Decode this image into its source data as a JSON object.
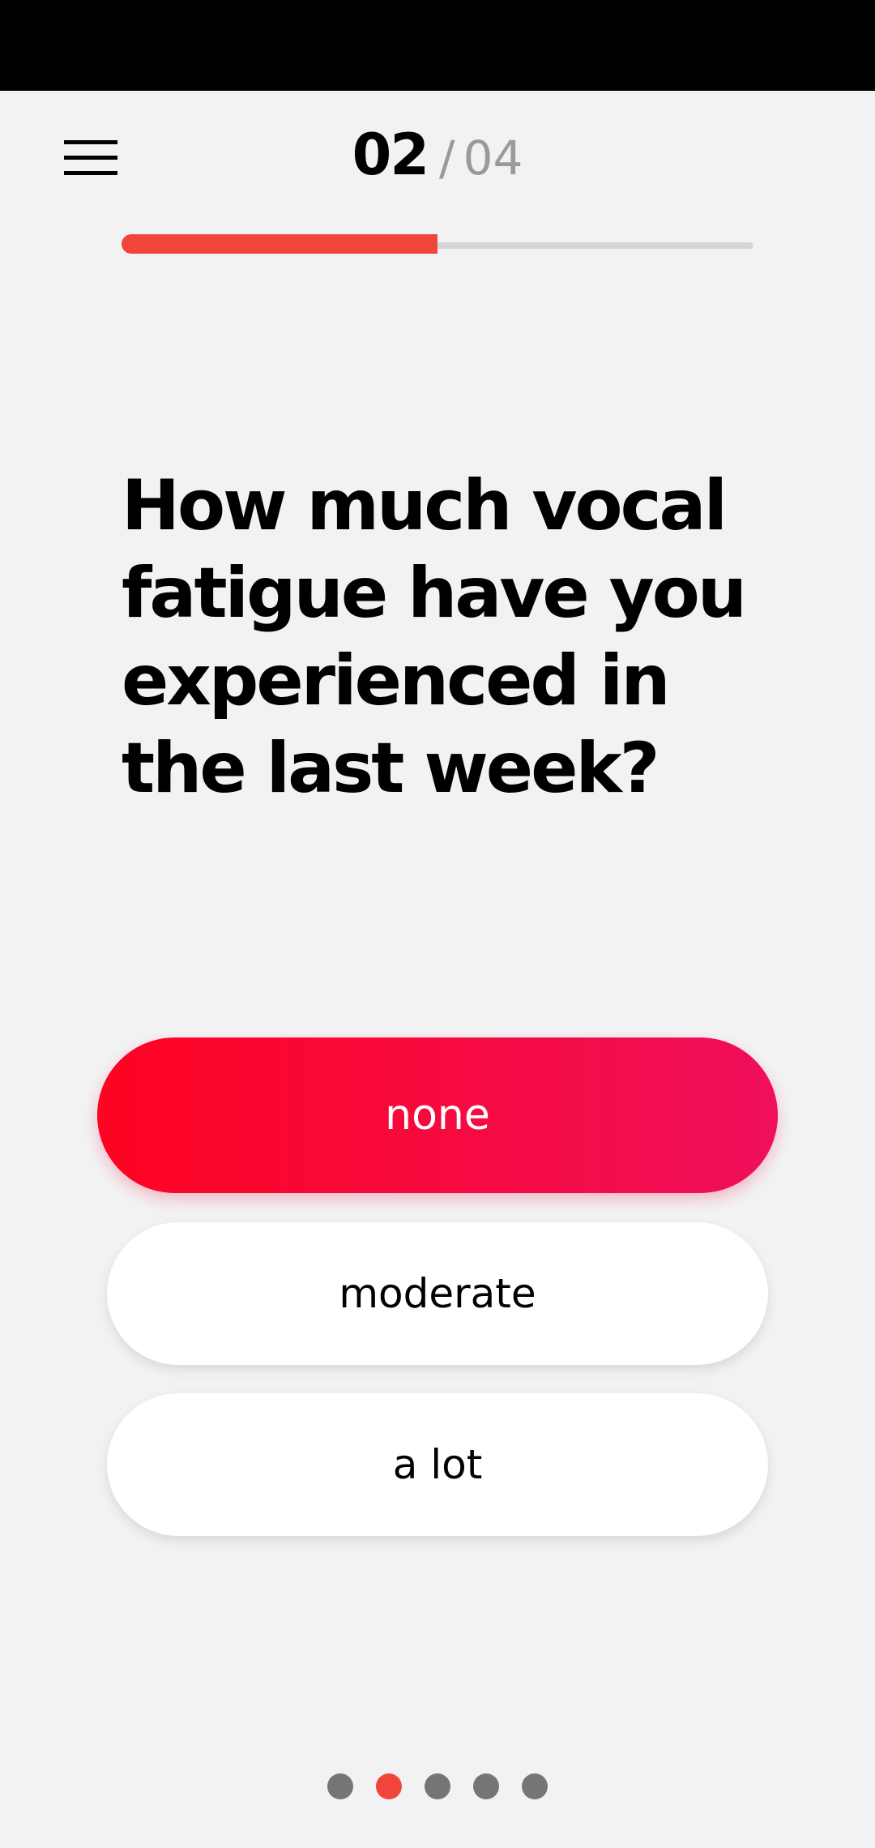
{
  "header": {
    "menu_icon": "hamburger-menu-icon",
    "current_step": "02",
    "separator": "/",
    "total_steps": "04"
  },
  "progress": {
    "fraction": 0.5,
    "fill_color": "#f1453c",
    "track_color": "#d6d6d8"
  },
  "question": {
    "text": "How much vocal fatigue have you experienced in the last week?"
  },
  "answers": [
    {
      "label": "none",
      "selected": true
    },
    {
      "label": "moderate",
      "selected": false
    },
    {
      "label": "a lot",
      "selected": false
    }
  ],
  "pager": {
    "count": 5,
    "active_index": 1,
    "active_color": "#f1453c",
    "inactive_color": "#757575"
  },
  "colors": {
    "accent_gradient_start": "#fd0422",
    "accent_gradient_end": "#f00f5b",
    "background": "#f2f2f4"
  }
}
